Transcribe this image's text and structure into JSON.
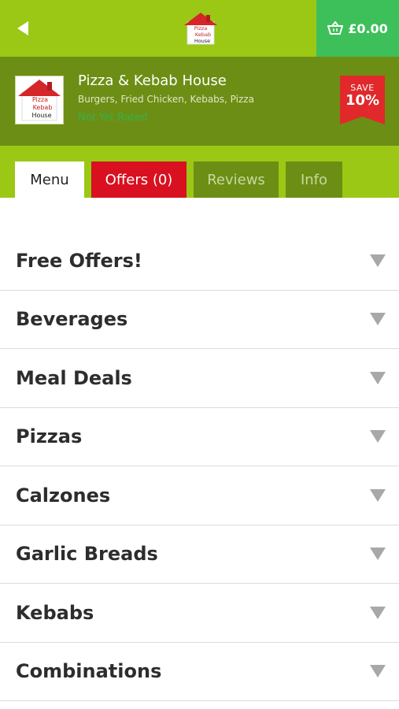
{
  "header": {
    "basket_total": "£0.00",
    "logo_text": [
      "Pizza",
      "Kebab",
      "House"
    ]
  },
  "restaurant": {
    "name": "Pizza & Kebab House",
    "cuisine": "Burgers, Fried Chicken, Kebabs, Pizza",
    "rating": "Not Yet Rated",
    "save_label": "SAVE",
    "save_value": "10%"
  },
  "tabs": [
    {
      "label": "Menu"
    },
    {
      "label": "Offers (0)"
    },
    {
      "label": "Reviews"
    },
    {
      "label": "Info"
    }
  ],
  "categories": [
    {
      "label": "Free Offers!"
    },
    {
      "label": "Beverages"
    },
    {
      "label": "Meal Deals"
    },
    {
      "label": "Pizzas"
    },
    {
      "label": "Calzones"
    },
    {
      "label": "Garlic Breads"
    },
    {
      "label": "Kebabs"
    },
    {
      "label": "Combinations"
    }
  ],
  "colors": {
    "top_bar": "#9bc814",
    "header_band": "#6d8e14",
    "basket": "#3dbf5a",
    "offers_tab": "#d8101f",
    "save_badge": "#e1282b",
    "rating_text": "#34b24c"
  },
  "icons": {
    "back": "back-arrow-icon",
    "basket": "basket-icon",
    "chevron": "chevron-down-icon"
  }
}
